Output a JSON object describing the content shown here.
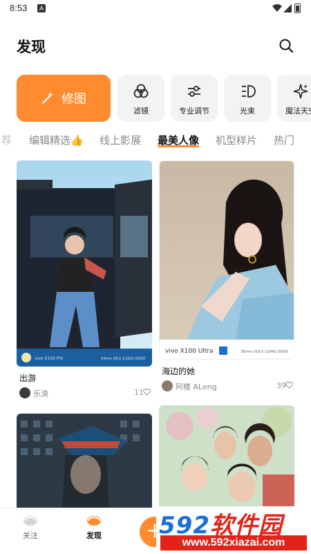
{
  "status_bar": {
    "time": "8:53",
    "notif_letter": "A"
  },
  "header": {
    "title": "发现"
  },
  "tools": {
    "retouch_label": "修图",
    "items": [
      {
        "label": "滤镜",
        "icon": "filter-circles-icon"
      },
      {
        "label": "专业调节",
        "icon": "sliders-icon"
      },
      {
        "label": "光束",
        "icon": "light-beam-icon"
      },
      {
        "label": "魔法天空",
        "icon": "sparkle-icon"
      }
    ]
  },
  "tabs": [
    "荐",
    "编辑精选👍",
    "线上影展",
    "最美人像",
    "机型样片",
    "热门"
  ],
  "active_tab": "最美人像",
  "feed": {
    "cards": [
      {
        "title": "出游",
        "author": "乐涣",
        "likes": "11",
        "watermark": "vivo X100 Pro",
        "exif": "24mm f/8.0 1/102s ISO50"
      },
      {
        "title": "海边的她",
        "author": "阿楼 ALeng",
        "likes": "39",
        "watermark": "vivo X100 Ultra",
        "exif": "85mm f/16.0 1/246s ISO50"
      }
    ]
  },
  "bottom_nav": {
    "follow": "关注",
    "discover": "发现",
    "plus": "+"
  },
  "brand_overlay": {
    "numbers": "592",
    "name": "软件园",
    "url": "www.592xiazai.com"
  },
  "colors": {
    "accent": "#ff8b2e",
    "brand_red": "#e2231a",
    "brand_blue": "#1a6fd4"
  }
}
